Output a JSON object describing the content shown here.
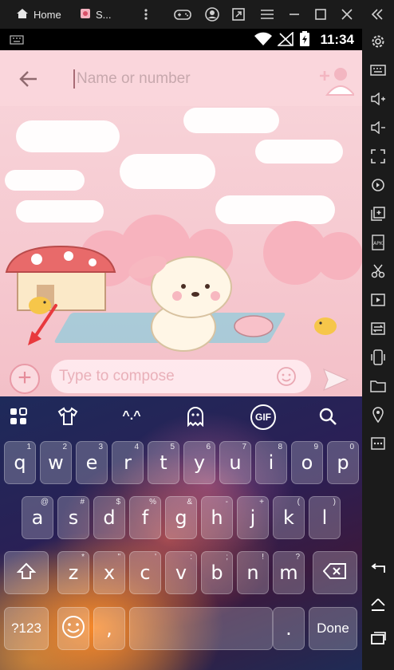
{
  "emulator": {
    "tabs": [
      {
        "label": "Home"
      },
      {
        "label": "S..."
      }
    ]
  },
  "statusbar": {
    "time": "11:34"
  },
  "header": {
    "recipient_placeholder": "Name or number"
  },
  "compose": {
    "placeholder": "Type to compose"
  },
  "keyboard": {
    "toolbar": [
      "apps-icon",
      "theme-icon",
      "emoticon-icon",
      "ghost-icon",
      "gif-icon",
      "search-icon"
    ],
    "toolbar_text": {
      "emoticon": "^.^",
      "gif": "GIF"
    },
    "row1": [
      {
        "ch": "q",
        "hint": "1"
      },
      {
        "ch": "w",
        "hint": "2"
      },
      {
        "ch": "e",
        "hint": "3"
      },
      {
        "ch": "r",
        "hint": "4"
      },
      {
        "ch": "t",
        "hint": "5"
      },
      {
        "ch": "y",
        "hint": "6"
      },
      {
        "ch": "u",
        "hint": "7"
      },
      {
        "ch": "i",
        "hint": "8"
      },
      {
        "ch": "o",
        "hint": "9"
      },
      {
        "ch": "p",
        "hint": "0"
      }
    ],
    "row2": [
      {
        "ch": "a",
        "hint": "@"
      },
      {
        "ch": "s",
        "hint": "#"
      },
      {
        "ch": "d",
        "hint": "$"
      },
      {
        "ch": "f",
        "hint": "%"
      },
      {
        "ch": "g",
        "hint": "&"
      },
      {
        "ch": "h",
        "hint": "-"
      },
      {
        "ch": "j",
        "hint": "+"
      },
      {
        "ch": "k",
        "hint": "("
      },
      {
        "ch": "l",
        "hint": ")"
      }
    ],
    "row3": [
      {
        "ch": "z",
        "hint": "*"
      },
      {
        "ch": "x",
        "hint": "\""
      },
      {
        "ch": "c",
        "hint": "'"
      },
      {
        "ch": "v",
        "hint": ":"
      },
      {
        "ch": "b",
        "hint": ";"
      },
      {
        "ch": "n",
        "hint": "!"
      },
      {
        "ch": "m",
        "hint": "?"
      }
    ],
    "symbols_label": "?123",
    "comma": ",",
    "period": ".",
    "done_label": "Done"
  },
  "colors": {
    "accent_pink": "#e58c9a",
    "arrow_red": "#e8393d"
  }
}
